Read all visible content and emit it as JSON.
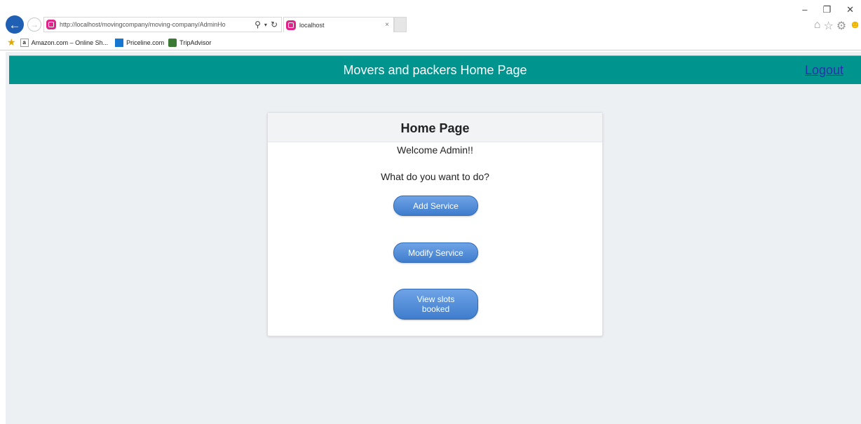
{
  "browser": {
    "url": "http://localhost/movingcompany/moving-company/AdminHo",
    "tab_title": "localhost",
    "tab_close": "×",
    "win_minimize": "–",
    "win_restore": "❐",
    "win_close": "✕",
    "favorites": [
      {
        "label": "Amazon.com – Online Sh..."
      },
      {
        "label": "Priceline.com"
      },
      {
        "label": "TripAdvisor"
      }
    ]
  },
  "header": {
    "title": "Movers and packers Home Page",
    "logout_label": "Logout"
  },
  "card": {
    "title": "Home Page",
    "welcome": "Welcome Admin!!",
    "question": "What do you want to do?",
    "buttons": {
      "add": "Add Service",
      "modify": "Modify Service",
      "view": "View slots booked"
    }
  },
  "colors": {
    "header_bg": "#00948f",
    "page_bg": "#edf0f3",
    "button_blue": "#4a86d4",
    "logout_link": "#2b2fae"
  }
}
